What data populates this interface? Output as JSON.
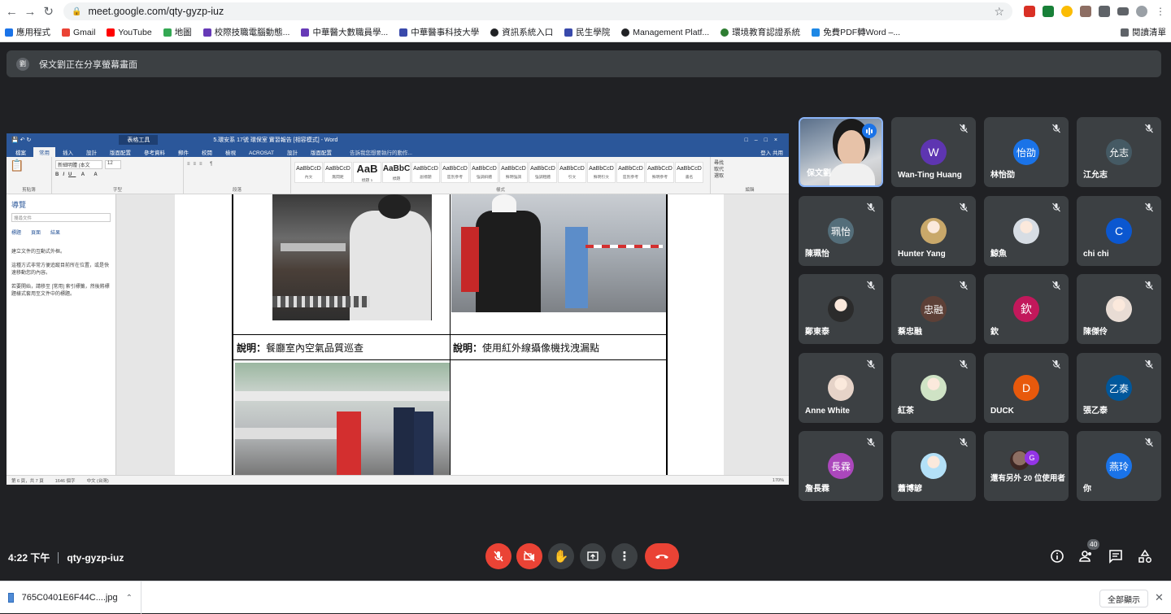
{
  "browser": {
    "url": "meet.google.com/qty-gyzp-iuz",
    "bookmarks": [
      "應用程式",
      "Gmail",
      "YouTube",
      "地圖",
      "校際技職電腦動態...",
      "中華醫大數職員學...",
      "中華醫事科技大學",
      "資訊系統入口",
      "民生學院",
      "Management Platf...",
      "環境教育認證系統",
      "免費PDF轉Word –..."
    ],
    "reading_list": "閱讀清單"
  },
  "banner": {
    "avatar": "劉",
    "text": "保文劉正在分享螢幕畫面"
  },
  "word": {
    "title_context": "表格工具",
    "title_caption": "5.環安系 17號 環保室 實習報告 [相容模式] - Word",
    "tabs": [
      "檔案",
      "常用",
      "插入",
      "設計",
      "版面配置",
      "參考資料",
      "郵件",
      "校閱",
      "檢視",
      "ACROSAT",
      "設計",
      "版面配置"
    ],
    "tell_me": "告訴我您想要執行的動作...",
    "account": "登入  共用",
    "groups": [
      "剪貼簿",
      "字型",
      "段落",
      "樣式",
      "編輯"
    ],
    "font_name": "新細明體 (本文",
    "font_size": "12",
    "styles": [
      {
        "sample": "AaBbCcD",
        "name": "內文"
      },
      {
        "sample": "AaBbCcD",
        "name": "無間距"
      },
      {
        "sample": "AaB",
        "name": "標題 1"
      },
      {
        "sample": "AaBbC",
        "name": "標題"
      },
      {
        "sample": "AaBbCcD",
        "name": "副標題"
      },
      {
        "sample": "AaBbCcD",
        "name": "區別參考"
      },
      {
        "sample": "AaBbCcD",
        "name": "強調斜體"
      },
      {
        "sample": "AaBbCcD",
        "name": "鮮明強調"
      },
      {
        "sample": "AaBbCcD",
        "name": "強調粗體"
      },
      {
        "sample": "AaBbCcD",
        "name": "引文"
      },
      {
        "sample": "AaBbCcD",
        "name": "鮮明引文"
      },
      {
        "sample": "AaBbCcD",
        "name": "區別參考"
      },
      {
        "sample": "AaBbCcD",
        "name": "鮮明參考"
      },
      {
        "sample": "AaBbCcD",
        "name": "書名"
      }
    ],
    "edit_items": [
      "尋找",
      "取代",
      "選取"
    ],
    "nav": {
      "title": "導覽",
      "search": "搜尋文件",
      "tabs": [
        "標題",
        "頁面",
        "結果"
      ],
      "notes": [
        "建立文件的互動式外框。",
        "這種方式非常方便追蹤目前所在位置，或是快速移動您的內容。",
        "若要開始，請移至 [常用] 索引標籤，然後將標題樣式套用至文件中的標題。"
      ]
    },
    "captions": [
      {
        "label": "說明：",
        "text": "餐廳室內空氣品質巡查"
      },
      {
        "label": "說明：",
        "text": "使用紅外線攝像機找洩漏點"
      }
    ],
    "status": {
      "page": "第 6 頁，共 7 頁",
      "words": "1646 個字",
      "lang": "中文 (台灣)",
      "zoom": "170%"
    }
  },
  "participants": [
    {
      "name": "保文劉",
      "initial": "",
      "color": "",
      "self": true
    },
    {
      "name": "Wan-Ting Huang",
      "initial": "W",
      "color": "#5e35b1"
    },
    {
      "name": "林怡劭",
      "initial": "怡劭",
      "color": "#1a73e8"
    },
    {
      "name": "江允志",
      "initial": "允志",
      "color": "#455a64"
    },
    {
      "name": "陳珮怡",
      "initial": "珮怡",
      "color": "#546e7a"
    },
    {
      "name": "Hunter Yang",
      "initial": "",
      "color": "#c9a86a"
    },
    {
      "name": "鯨魚",
      "initial": "",
      "color": "#d7dde4"
    },
    {
      "name": "chi chi",
      "initial": "C",
      "color": "#0b57d0"
    },
    {
      "name": "鄭東泰",
      "initial": "",
      "color": "#2b2b2b"
    },
    {
      "name": "蔡忠融",
      "initial": "忠融",
      "color": "#5d4037"
    },
    {
      "name": "欽",
      "initial": "欽",
      "color": "#c2185b"
    },
    {
      "name": "陳傑伶",
      "initial": "",
      "color": "#e8dcd4"
    },
    {
      "name": "Anne White",
      "initial": "",
      "color": "#e6d3c8"
    },
    {
      "name": "紅茶",
      "initial": "",
      "color": "#cfe3c5"
    },
    {
      "name": "DUCK",
      "initial": "D",
      "color": "#e8590c"
    },
    {
      "name": "張乙泰",
      "initial": "乙泰",
      "color": "#01579b"
    },
    {
      "name": "詹長霖",
      "initial": "長霖",
      "color": "#ab47bc"
    },
    {
      "name": "蕭博諺",
      "initial": "",
      "color": "#b3e0f7"
    },
    {
      "name": "還有另外 20 位使用者",
      "initial": "G",
      "color": "#9334e6",
      "others": true
    },
    {
      "name": "你",
      "initial": "燕玲",
      "color": "#1a73e8"
    }
  ],
  "meeting": {
    "time": "4:22 下午",
    "code": "qty-gyzp-iuz",
    "participant_count": "40"
  },
  "download": {
    "file": "765C0401E6F44C....jpg",
    "show_all": "全部顯示"
  }
}
